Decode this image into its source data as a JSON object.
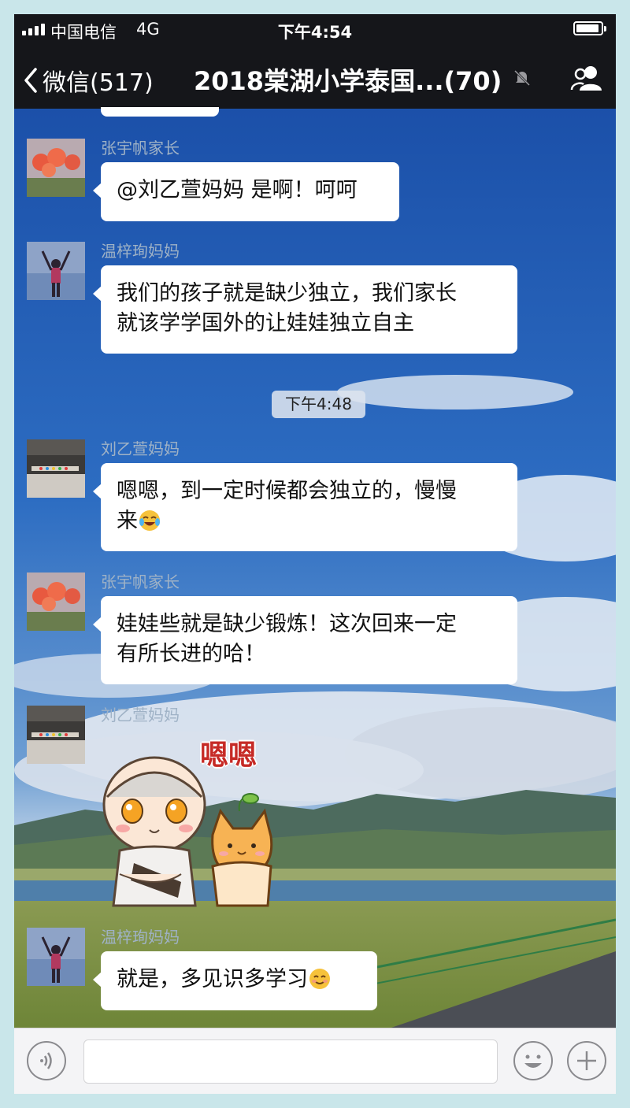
{
  "status_bar": {
    "carrier": "中国电信",
    "network": "4G",
    "time": "下午4:54"
  },
  "nav": {
    "back_label": "微信(517)",
    "title": "2018棠湖小学泰国...(70)"
  },
  "messages": [
    {
      "sender": "张宇帆家长",
      "lines": [
        "@刘乙萱妈妈 是啊！呵呵"
      ]
    },
    {
      "sender": "温梓珣妈妈",
      "lines": [
        "我们的孩子就是缺少独立，我们家长",
        "就该学学国外的让娃娃独立自主"
      ]
    },
    {
      "sender": "刘乙萱妈妈",
      "lines": [
        "嗯嗯，到一定时候都会独立的，慢慢",
        "来"
      ]
    },
    {
      "sender": "张宇帆家长",
      "lines": [
        "娃娃些就是缺少锻炼！这次回来一定",
        "有所长进的哈！"
      ]
    },
    {
      "sender": "刘乙萱妈妈",
      "sticker_text": "嗯嗯"
    },
    {
      "sender": "温梓珣妈妈",
      "lines": [
        "就是，多见识多学习"
      ]
    }
  ],
  "timestamp_chip": "下午4:48",
  "icons": {
    "back": "chevron-left-icon",
    "mute": "bell-muted-icon",
    "members": "people-icon",
    "voice": "voice-icon",
    "emoji": "smiley-icon",
    "more": "plus-icon"
  },
  "colors": {
    "nav_bg": "#15161a",
    "bubble_bg": "#ffffff",
    "sender_text": "#9fb2c6"
  }
}
